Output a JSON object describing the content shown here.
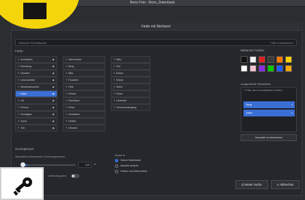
{
  "window": {
    "title": "Boris Foto - Boris_Datenbank"
  },
  "dialog": {
    "title": "Finde mit Stichwort"
  },
  "search": {
    "placeholder": "Stichwort Schnellsuche",
    "filter_label": "Filter zurücksetzen"
  },
  "lists": {
    "label": "Farbe",
    "col1": [
      {
        "label": "Architektur",
        "arrow": "▶"
      },
      {
        "label": "Fahrzeug",
        "arrow": "▶"
      },
      {
        "label": "Gewicht",
        "arrow": "▶"
      },
      {
        "label": "Lebensmittel",
        "arrow": "▶"
      },
      {
        "label": "Musikinstrument",
        "arrow": "▶"
      },
      {
        "label": "Natur",
        "arrow": "▶",
        "selected": true
      },
      {
        "label": "Ort",
        "arrow": "▶"
      },
      {
        "label": "Person",
        "arrow": "▶"
      },
      {
        "label": "Sonstiges",
        "arrow": "▶"
      },
      {
        "label": "Sport",
        "arrow": "▶"
      },
      {
        "label": "Tier",
        "arrow": "▶"
      }
    ],
    "col2": [
      {
        "label": "Astronomie"
      },
      {
        "label": "Berg"
      },
      {
        "label": "Blitz"
      },
      {
        "label": "Fossilien"
      },
      {
        "label": "Feld"
      },
      {
        "label": "Felsen"
      },
      {
        "label": "Flachland"
      },
      {
        "label": "Fluss"
      },
      {
        "label": "Gewässer"
      },
      {
        "label": "Herbst"
      },
      {
        "label": "Himmel"
      }
    ],
    "col3": [
      {
        "label": "Blau"
      },
      {
        "label": "Rot"
      },
      {
        "label": "Braun"
      },
      {
        "label": "Wiese"
      },
      {
        "label": "Mohn"
      },
      {
        "label": "Rosa"
      },
      {
        "label": "Lavendel"
      },
      {
        "label": "Sonnenuntergang"
      }
    ]
  },
  "colors": {
    "label": "Bekannte Farben",
    "swatches": [
      "#111111",
      "#f2f2f2",
      "#e02020",
      "#3a3a3a",
      "#ff7a00",
      "#ffd000",
      "#ffffff",
      "#f4c1d0",
      "#8a2be2",
      "#00c800",
      "#1e5bff",
      "#ffa500"
    ]
  },
  "selected": {
    "label": "Ausgewählte Stichwörter",
    "hint": "1 Filter, die im Suchkriterien erfüllen",
    "items": [
      {
        "label": "Berg",
        "remove": "×"
      },
      {
        "label": "Natur",
        "remove": "×"
      }
    ]
  },
  "advanced_button": "Auswahl zurücksetzen",
  "settings": {
    "label": "Suchoptionen",
    "text": "Stichwörter-Ähnlichkeit in Suchergebnissen",
    "value": "110",
    "unit": "%",
    "toggle_label": "Unterkategorien"
  },
  "find": {
    "label": "Suche in",
    "options": [
      {
        "label": "Ganze Datenbank",
        "selected": true
      },
      {
        "label": "Aktuelle Ansicht",
        "selected": false
      },
      {
        "label": "Ordner und Unterordner",
        "selected": false
      }
    ]
  },
  "buttons": {
    "search": "Q  Weiter Suche",
    "cancel": "✕  Abbrechen"
  }
}
